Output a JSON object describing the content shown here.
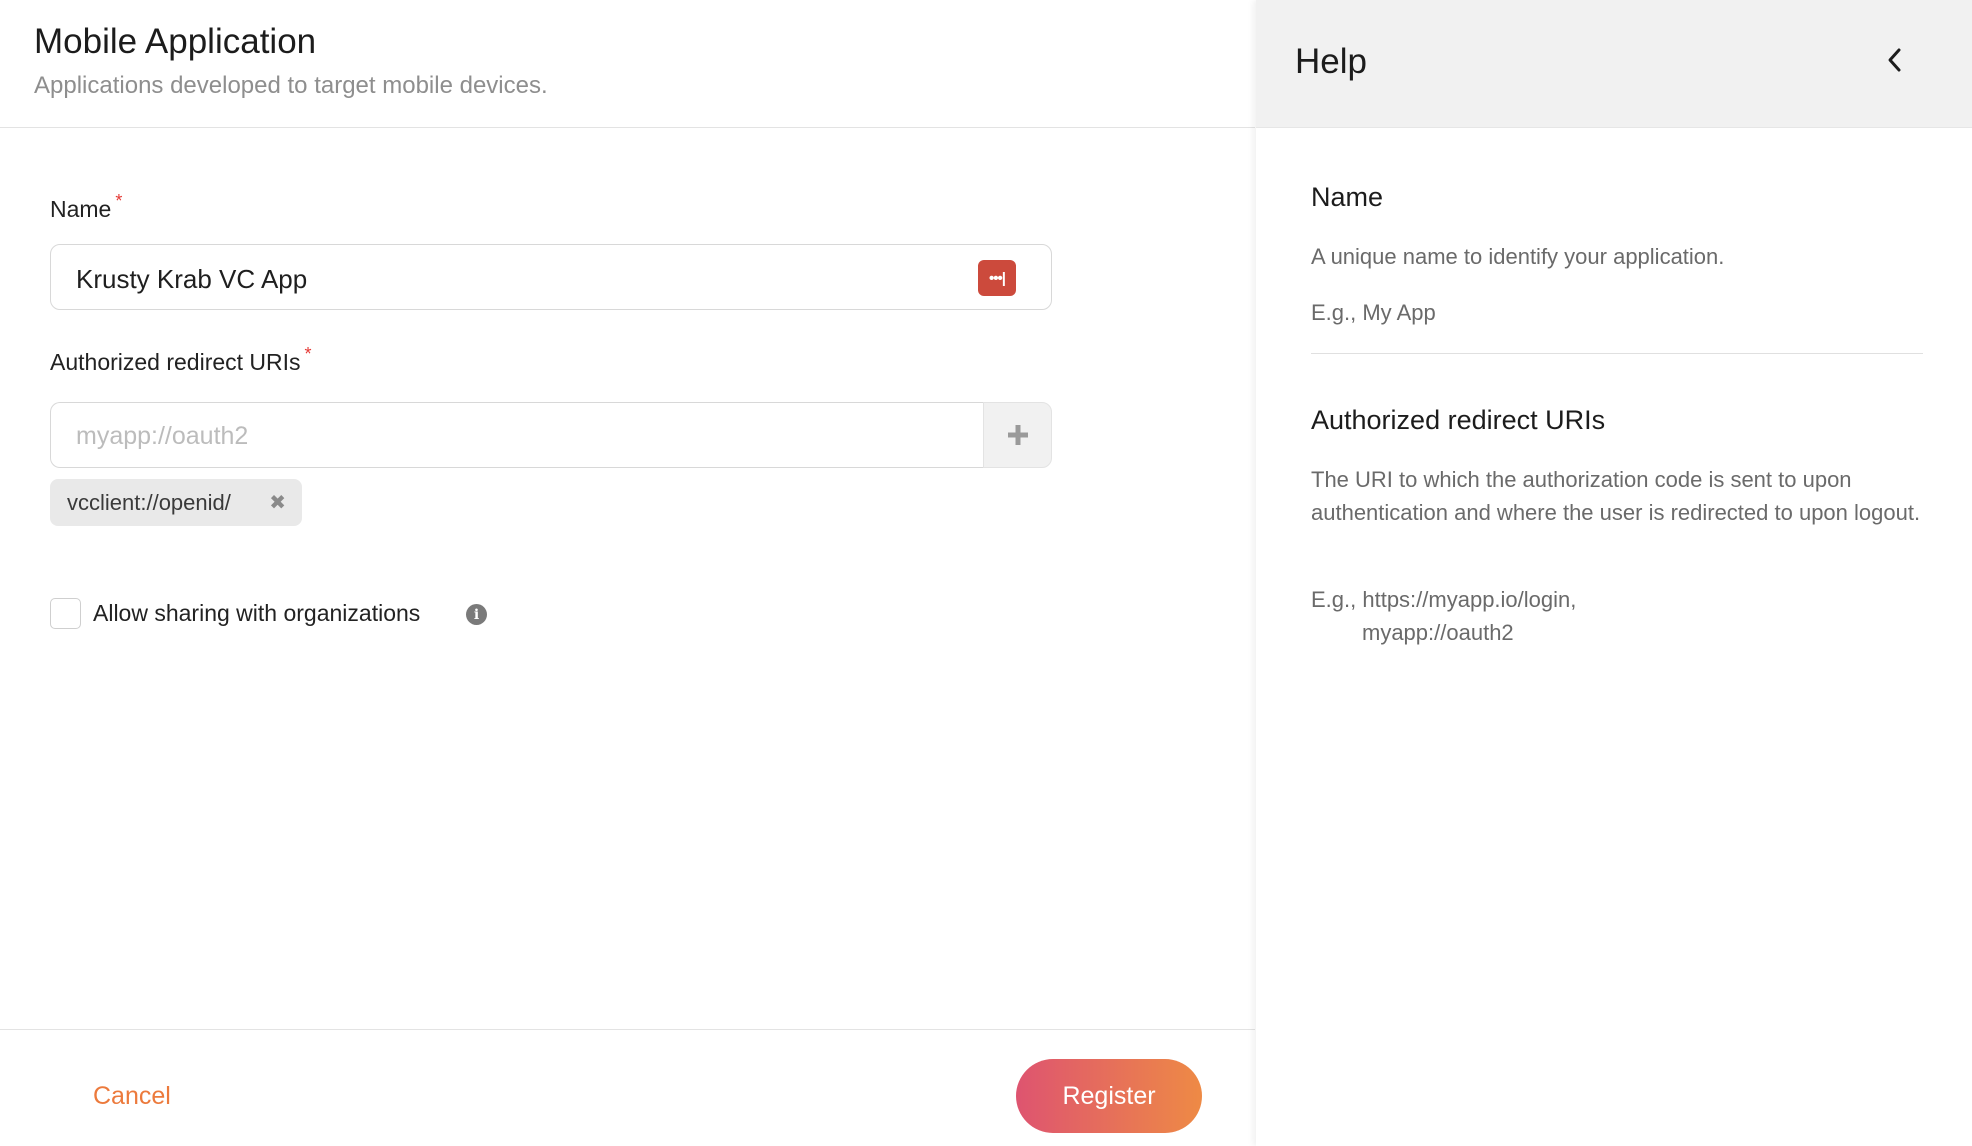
{
  "wizard": {
    "title": "Mobile Application",
    "subtitle": "Applications developed to target mobile devices.",
    "name_field": {
      "label": "Name",
      "required_mark": "*",
      "value": "Krusty Krab VC App",
      "password_manager_badge": "•••|"
    },
    "uri_field": {
      "label": "Authorized redirect URIs",
      "required_mark": "*",
      "placeholder": "myapp://oauth2",
      "add_icon": "plus-icon",
      "chips": [
        {
          "label": "vcclient://openid/",
          "remove_icon": "close-icon"
        }
      ]
    },
    "sharing": {
      "label": "Allow sharing with organizations",
      "checked": false,
      "info_icon": "info-icon"
    },
    "footer": {
      "cancel_label": "Cancel",
      "register_label": "Register"
    }
  },
  "help": {
    "title": "Help",
    "collapse_icon": "chevron-left-icon",
    "sections": [
      {
        "heading": "Name",
        "description": "A unique name to identify your application.",
        "example": "E.g., My App"
      },
      {
        "heading": "Authorized redirect URIs",
        "description": "The URI to which the authorization code is sent to upon authentication and where the user is redirected to upon logout.",
        "example_prefix": "E.g., https://myapp.io/login,",
        "example_cont": "myapp://oauth2"
      }
    ]
  },
  "colors": {
    "accent_orange": "#ec7a3c",
    "register_gradient_start": "#de5470",
    "register_gradient_end": "#ee8a45",
    "required_red": "#e53935"
  }
}
